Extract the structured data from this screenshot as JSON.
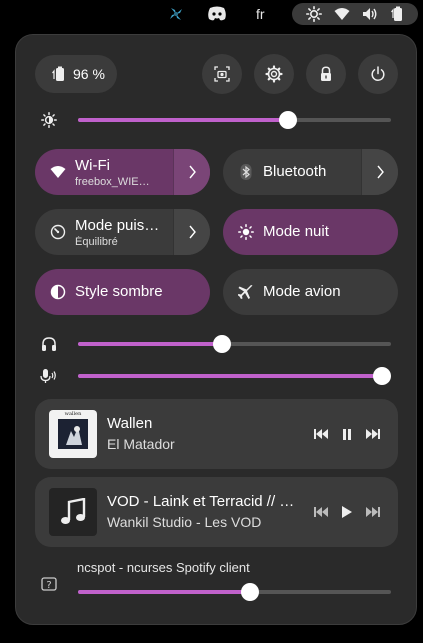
{
  "topbar": {
    "language": "fr",
    "tray_icons": [
      "fan-icon",
      "discord-icon"
    ],
    "status_icons": [
      "brightness-icon",
      "wifi-icon",
      "volume-icon",
      "battery-icon"
    ]
  },
  "quick_settings": {
    "battery": {
      "label": "96 %",
      "level": 0.96
    },
    "actions": [
      "screenshot-button",
      "settings-button",
      "lock-button",
      "power-button"
    ],
    "brightness": {
      "level": 0.67
    },
    "toggles": [
      {
        "id": "wifi",
        "label": "Wi-Fi",
        "subtitle": "freebox_WIE…",
        "active": true,
        "has_arrow": true
      },
      {
        "id": "bluetooth",
        "label": "Bluetooth",
        "subtitle": "",
        "active": false,
        "has_arrow": true
      },
      {
        "id": "power-mode",
        "label": "Mode puis…",
        "subtitle": "Équilibré",
        "active": false,
        "has_arrow": true
      },
      {
        "id": "night-mode",
        "label": "Mode nuit",
        "subtitle": "",
        "active": true,
        "has_arrow": false
      },
      {
        "id": "dark-style",
        "label": "Style sombre",
        "subtitle": "",
        "active": true,
        "has_arrow": false
      },
      {
        "id": "airplane-mode",
        "label": "Mode avion",
        "subtitle": "",
        "active": false,
        "has_arrow": false
      }
    ],
    "output_volume": {
      "level": 0.46
    },
    "input_volume": {
      "level": 0.98
    },
    "media": [
      {
        "title": "Wallen",
        "artist": "El Matador",
        "playing": true,
        "art_text": "wallen"
      },
      {
        "title": "VOD - Laink et Terracid // …",
        "artist": "Wankil Studio - Les VOD",
        "playing": false
      }
    ],
    "app_volume": {
      "name": "ncspot - ncurses Spotify client",
      "level": 0.55
    }
  },
  "colors": {
    "accent": "#c061cb",
    "toggle_on": "#6a3767",
    "panel_bg": "#2a2a2a",
    "button_bg": "#3b3b3b"
  }
}
